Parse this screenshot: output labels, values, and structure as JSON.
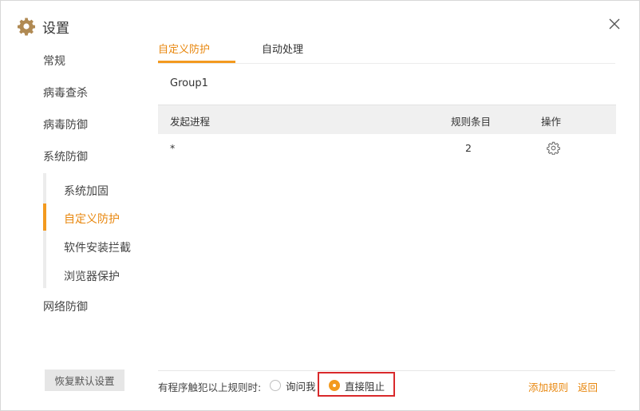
{
  "window": {
    "title": "设置"
  },
  "sidebar": {
    "items": [
      {
        "label": "常规"
      },
      {
        "label": "病毒查杀"
      },
      {
        "label": "病毒防御"
      },
      {
        "label": "系统防御"
      },
      {
        "label": "网络防御"
      }
    ],
    "subitems": [
      {
        "label": "系统加固"
      },
      {
        "label": "自定义防护",
        "active": true
      },
      {
        "label": "软件安装拦截"
      },
      {
        "label": "浏览器保护"
      }
    ],
    "reset_label": "恢复默认设置"
  },
  "tabs": [
    {
      "label": "自定义防护",
      "active": true
    },
    {
      "label": "自动处理"
    }
  ],
  "group": {
    "name": "Group1"
  },
  "table": {
    "headers": [
      "发起进程",
      "规则条目",
      "操作"
    ],
    "rows": [
      {
        "process": "*",
        "count": "2",
        "action_icon": "gear-icon"
      }
    ]
  },
  "footer": {
    "label": "有程序触犯以上规则时:",
    "options": [
      {
        "label": "询问我",
        "checked": false
      },
      {
        "label": "直接阻止",
        "checked": true
      }
    ],
    "add_rule": "添加规则",
    "back": "返回"
  },
  "colors": {
    "accent": "#f39a1f",
    "accent_text": "#e8870e",
    "highlight": "#d9292b"
  }
}
